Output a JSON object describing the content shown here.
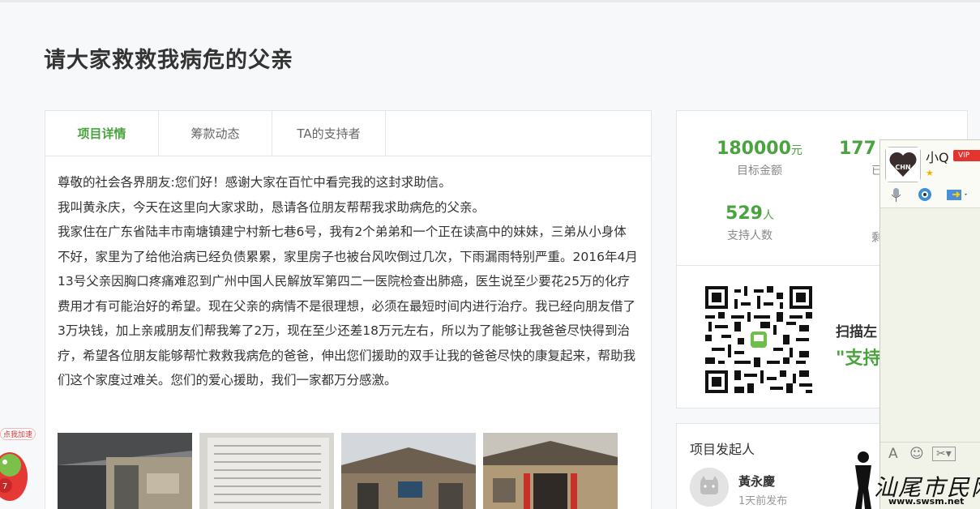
{
  "page_title": "请大家救救我病危的父亲",
  "tabs": [
    {
      "label": "项目详情",
      "active": true
    },
    {
      "label": "筹款动态",
      "active": false
    },
    {
      "label": "TA的支持者",
      "active": false
    }
  ],
  "story": [
    "尊敬的社会各界朋友:您们好！感谢大家在百忙中看完我的这封求助信。",
    "我叫黄永庆，今天在这里向大家求助，恳请各位朋友帮帮我求助病危的父亲。",
    "我家住在广东省陆丰市南塘镇建宁村新七巷6号，我有2个弟弟和一个正在读高中的妹妹，三弟从小身体不好，家里为了给他治病已经负债累累，家里房子也被台风吹倒过几次，下雨漏雨特别严重。2016年4月13号父亲因胸口疼痛难忍到广州中国人民解放军第四二一医院检查出肺癌，医生说至少要花25万的化疗费用才有可能治好的希望。现在父亲的病情不是很理想，必须在最短时间内进行治疗。我已经向朋友借了3万块钱，加上亲戚朋友们帮我筹了2万，现在至少还差18万元左右，所以为了能够让我爸爸尽快得到治疗，希望各位朋友能够帮忙救救我病危的爸爸，伸出您们援助的双手让我的爸爸尽快的康复起来，帮助我们这个家度过难关。您们的爱心援助，我们一家都万分感激。"
  ],
  "stats": {
    "goal_amount": "180000",
    "goal_unit": "元",
    "goal_label": "目标金额",
    "raised_amount": "177",
    "raised_label": "已",
    "supporters": "529",
    "supporters_unit": "人",
    "supporters_label": "支持人数",
    "remaining_label": "剩"
  },
  "qr_prompt": "扫描左",
  "qr_support": "\"支持",
  "initiator": {
    "title": "项目发起人",
    "name": "黃永慶",
    "time": "1天前发布"
  },
  "qq": {
    "name": "小Q",
    "vip": "VIP",
    "avatar_text": "CHN"
  },
  "badge": {
    "label": "点我加速",
    "count": "7"
  },
  "watermark": {
    "text": "汕尾市民网",
    "url": "www.swsm.net"
  },
  "colors": {
    "accent": "#4aa33f",
    "vip": "#e3342f"
  }
}
